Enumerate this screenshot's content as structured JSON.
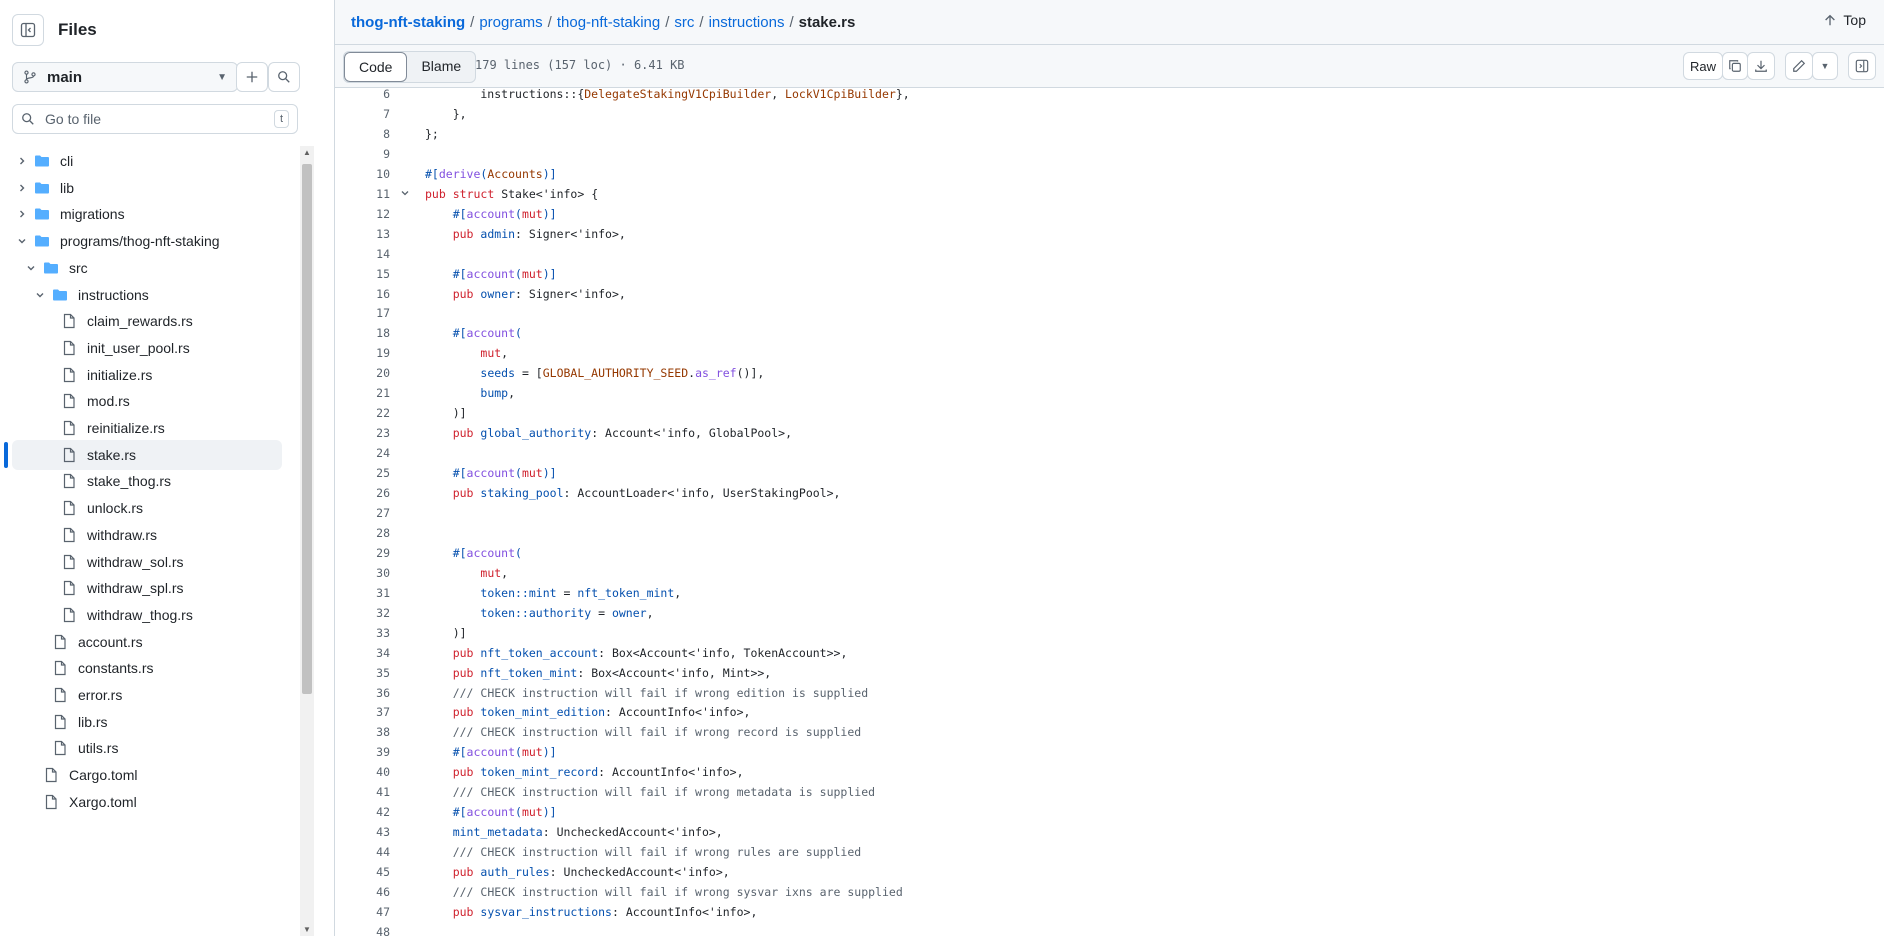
{
  "sidebar": {
    "title": "Files",
    "branch": "main",
    "goto_placeholder": "Go to file",
    "goto_shortcut": "t",
    "tree": [
      {
        "label": "cli",
        "type": "folder",
        "depth": 0,
        "expanded": false
      },
      {
        "label": "lib",
        "type": "folder",
        "depth": 0,
        "expanded": false
      },
      {
        "label": "migrations",
        "type": "folder",
        "depth": 0,
        "expanded": false
      },
      {
        "label": "programs/thog-nft-staking",
        "type": "folder",
        "depth": 0,
        "expanded": true
      },
      {
        "label": "src",
        "type": "folder",
        "depth": 1,
        "expanded": true
      },
      {
        "label": "instructions",
        "type": "folder",
        "depth": 2,
        "expanded": true
      },
      {
        "label": "claim_rewards.rs",
        "type": "file",
        "depth": 3
      },
      {
        "label": "init_user_pool.rs",
        "type": "file",
        "depth": 3
      },
      {
        "label": "initialize.rs",
        "type": "file",
        "depth": 3
      },
      {
        "label": "mod.rs",
        "type": "file",
        "depth": 3
      },
      {
        "label": "reinitialize.rs",
        "type": "file",
        "depth": 3
      },
      {
        "label": "stake.rs",
        "type": "file",
        "depth": 3,
        "selected": true
      },
      {
        "label": "stake_thog.rs",
        "type": "file",
        "depth": 3
      },
      {
        "label": "unlock.rs",
        "type": "file",
        "depth": 3
      },
      {
        "label": "withdraw.rs",
        "type": "file",
        "depth": 3
      },
      {
        "label": "withdraw_sol.rs",
        "type": "file",
        "depth": 3
      },
      {
        "label": "withdraw_spl.rs",
        "type": "file",
        "depth": 3
      },
      {
        "label": "withdraw_thog.rs",
        "type": "file",
        "depth": 3
      },
      {
        "label": "account.rs",
        "type": "file",
        "depth": 2
      },
      {
        "label": "constants.rs",
        "type": "file",
        "depth": 2
      },
      {
        "label": "error.rs",
        "type": "file",
        "depth": 2
      },
      {
        "label": "lib.rs",
        "type": "file",
        "depth": 2
      },
      {
        "label": "utils.rs",
        "type": "file",
        "depth": 2
      },
      {
        "label": "Cargo.toml",
        "type": "file",
        "depth": 1
      },
      {
        "label": "Xargo.toml",
        "type": "file",
        "depth": 1
      }
    ]
  },
  "breadcrumb": [
    {
      "label": "thog-nft-staking"
    },
    {
      "label": "programs"
    },
    {
      "label": "thog-nft-staking"
    },
    {
      "label": "src"
    },
    {
      "label": "instructions"
    },
    {
      "label": "stake.rs",
      "current": true
    }
  ],
  "top_link": "Top",
  "toolbar": {
    "code_label": "Code",
    "blame_label": "Blame",
    "file_info": "179 lines (157 loc) · 6.41 KB",
    "raw_label": "Raw"
  },
  "code_lines": [
    {
      "n": "6",
      "t": "        instructions::{DelegateStakingV1CpiBuilder, LockV1CpiBuilder},"
    },
    {
      "n": "7",
      "t": "    },"
    },
    {
      "n": "8",
      "t": "};"
    },
    {
      "n": "9",
      "t": ""
    },
    {
      "n": "10",
      "t": "#[derive(Accounts)]"
    },
    {
      "n": "11",
      "t": "pub struct Stake<'info> {",
      "fold": true
    },
    {
      "n": "12",
      "t": "    #[account(mut)]"
    },
    {
      "n": "13",
      "t": "    pub admin: Signer<'info>,"
    },
    {
      "n": "14",
      "t": ""
    },
    {
      "n": "15",
      "t": "    #[account(mut)]"
    },
    {
      "n": "16",
      "t": "    pub owner: Signer<'info>,"
    },
    {
      "n": "17",
      "t": ""
    },
    {
      "n": "18",
      "t": "    #[account("
    },
    {
      "n": "19",
      "t": "        mut,"
    },
    {
      "n": "20",
      "t": "        seeds = [GLOBAL_AUTHORITY_SEED.as_ref()],"
    },
    {
      "n": "21",
      "t": "        bump,"
    },
    {
      "n": "22",
      "t": "    )]"
    },
    {
      "n": "23",
      "t": "    pub global_authority: Account<'info, GlobalPool>,"
    },
    {
      "n": "24",
      "t": ""
    },
    {
      "n": "25",
      "t": "    #[account(mut)]"
    },
    {
      "n": "26",
      "t": "    pub staking_pool: AccountLoader<'info, UserStakingPool>,"
    },
    {
      "n": "27",
      "t": ""
    },
    {
      "n": "28",
      "t": ""
    },
    {
      "n": "29",
      "t": "    #[account("
    },
    {
      "n": "30",
      "t": "        mut,"
    },
    {
      "n": "31",
      "t": "        token::mint = nft_token_mint,"
    },
    {
      "n": "32",
      "t": "        token::authority = owner,"
    },
    {
      "n": "33",
      "t": "    )]"
    },
    {
      "n": "34",
      "t": "    pub nft_token_account: Box<Account<'info, TokenAccount>>,"
    },
    {
      "n": "35",
      "t": "    pub nft_token_mint: Box<Account<'info, Mint>>,"
    },
    {
      "n": "36",
      "t": "    /// CHECK instruction will fail if wrong edition is supplied"
    },
    {
      "n": "37",
      "t": "    pub token_mint_edition: AccountInfo<'info>,"
    },
    {
      "n": "38",
      "t": "    /// CHECK instruction will fail if wrong record is supplied"
    },
    {
      "n": "39",
      "t": "    #[account(mut)]"
    },
    {
      "n": "40",
      "t": "    pub token_mint_record: AccountInfo<'info>,"
    },
    {
      "n": "41",
      "t": "    /// CHECK instruction will fail if wrong metadata is supplied"
    },
    {
      "n": "42",
      "t": "    #[account(mut)]"
    },
    {
      "n": "43",
      "t": "    mint_metadata: UncheckedAccount<'info>,"
    },
    {
      "n": "44",
      "t": "    /// CHECK instruction will fail if wrong rules are supplied"
    },
    {
      "n": "45",
      "t": "    pub auth_rules: UncheckedAccount<'info>,"
    },
    {
      "n": "46",
      "t": "    /// CHECK instruction will fail if wrong sysvar ixns are supplied"
    },
    {
      "n": "47",
      "t": "    pub sysvar_instructions: AccountInfo<'info>,"
    },
    {
      "n": "48",
      "t": ""
    }
  ]
}
